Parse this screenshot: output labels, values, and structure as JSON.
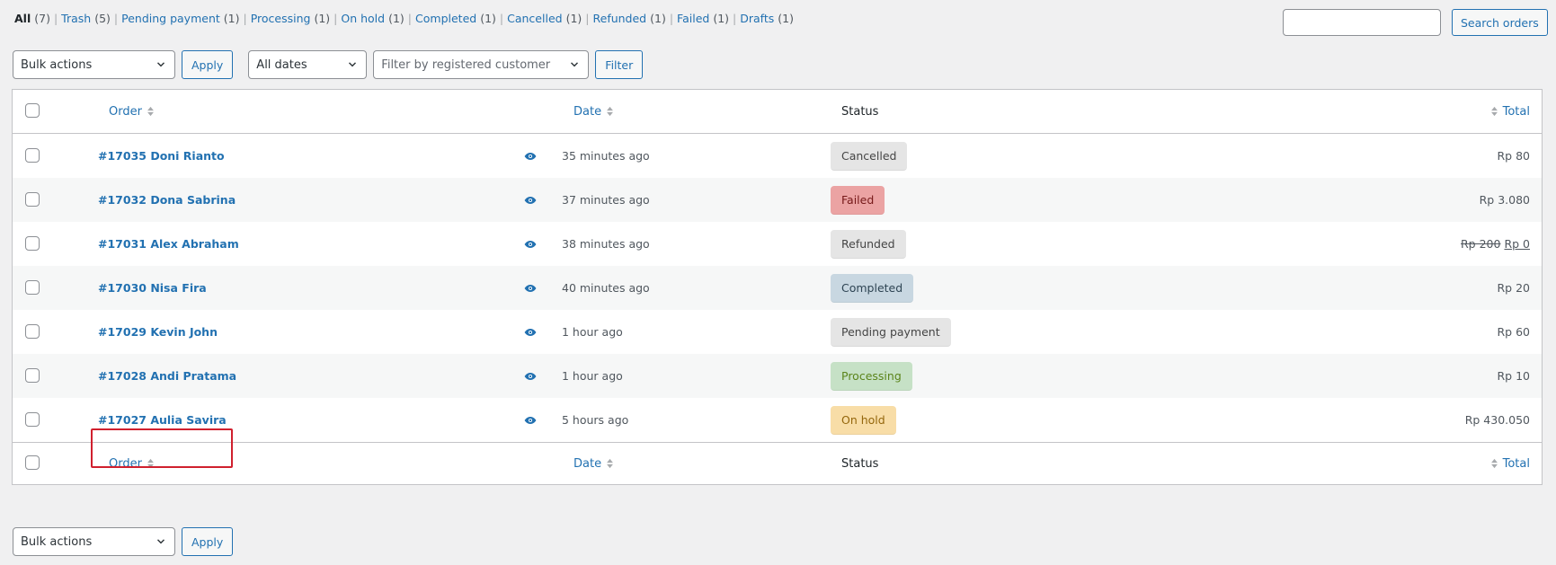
{
  "status_filters": [
    {
      "label": "All",
      "count": "(7)",
      "current": true
    },
    {
      "label": "Trash",
      "count": "(5)"
    },
    {
      "label": "Pending payment",
      "count": "(1)"
    },
    {
      "label": "Processing",
      "count": "(1)"
    },
    {
      "label": "On hold",
      "count": "(1)"
    },
    {
      "label": "Completed",
      "count": "(1)"
    },
    {
      "label": "Cancelled",
      "count": "(1)"
    },
    {
      "label": "Refunded",
      "count": "(1)"
    },
    {
      "label": "Failed",
      "count": "(1)"
    },
    {
      "label": "Drafts",
      "count": "(1)"
    }
  ],
  "search": {
    "value": "",
    "button_label": "Search orders"
  },
  "toolbar": {
    "bulk_actions": "Bulk actions",
    "apply_label": "Apply",
    "date_filter": "All dates",
    "customer_placeholder": "Filter by registered customer",
    "filter_label": "Filter"
  },
  "columns": {
    "order": "Order",
    "date": "Date",
    "status": "Status",
    "total": "Total"
  },
  "orders": [
    {
      "label": "#17035 Doni Rianto",
      "date": "35 minutes ago",
      "status": "Cancelled",
      "status_bg": "#e5e5e5",
      "status_color": "#454545",
      "total": "Rp 80"
    },
    {
      "label": "#17032 Dona Sabrina",
      "date": "37 minutes ago",
      "status": "Failed",
      "status_bg": "#eba3a3",
      "status_color": "#761919",
      "total": "Rp 3.080"
    },
    {
      "label": "#17031 Alex Abraham",
      "date": "38 minutes ago",
      "status": "Refunded",
      "status_bg": "#e5e5e5",
      "status_color": "#454545",
      "total": "Rp 0",
      "total_original": "Rp 200"
    },
    {
      "label": "#17030 Nisa Fira",
      "date": "40 minutes ago",
      "status": "Completed",
      "status_bg": "#c8d7e1",
      "status_color": "#2e4453",
      "total": "Rp 20"
    },
    {
      "label": "#17029 Kevin John",
      "date": "1 hour ago",
      "status": "Pending payment",
      "status_bg": "#e5e5e5",
      "status_color": "#454545",
      "total": "Rp 60"
    },
    {
      "label": "#17028 Andi Pratama",
      "date": "1 hour ago",
      "status": "Processing",
      "status_bg": "#c6e1c6",
      "status_color": "#5b841b",
      "total": "Rp 10"
    },
    {
      "label": "#17027 Aulia Savira",
      "date": "5 hours ago",
      "status": "On hold",
      "status_bg": "#f8dda7",
      "status_color": "#94660c",
      "total": "Rp 430.050"
    }
  ],
  "icons": {
    "preview": "eye-icon",
    "sort": "sort-arrows-icon",
    "dropdown": "chevron-down-icon"
  },
  "colors": {
    "link": "#2271b1",
    "highlight": "#d0202e"
  }
}
